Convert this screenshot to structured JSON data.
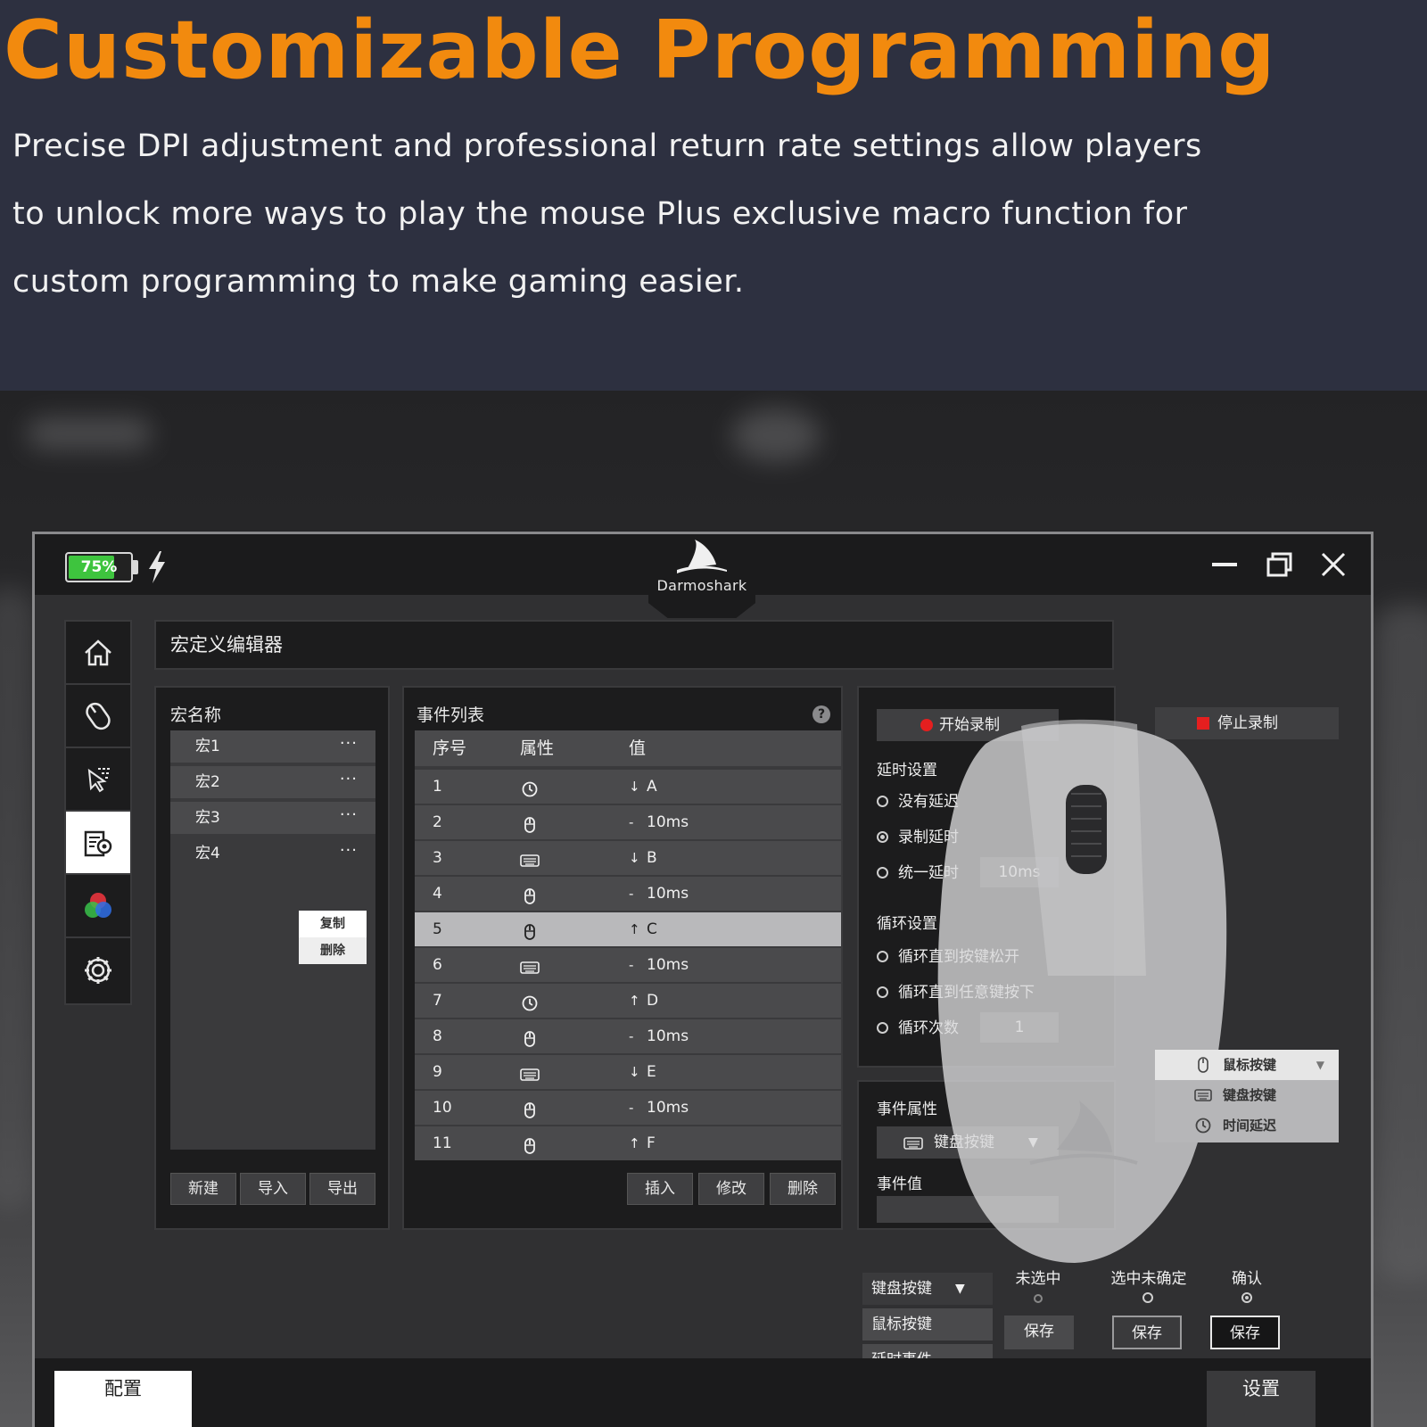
{
  "banner": {
    "title": "Customizable Programming",
    "description": "Precise DPI adjustment and professional return rate settings allow players to unlock more ways to play the mouse Plus exclusive macro function for custom programming to make gaming easier."
  },
  "colors": {
    "accent": "#f28a0e",
    "banner_bg": "#2d3040",
    "battery_green": "#3ec43e",
    "record_red": "#e51f1f"
  },
  "titlebar": {
    "battery": "75%",
    "battery_level": 0.75,
    "logo_text": "Darmoshark"
  },
  "icons": [
    "bolt-icon",
    "minimize-icon",
    "restore-icon",
    "close-icon",
    "home-icon",
    "mouse-icon",
    "cursor-select-icon",
    "macro-settings-icon",
    "color-rgb-icon",
    "gear-icon",
    "clock-icon",
    "mouse-small-icon",
    "keyboard-icon",
    "help-icon",
    "record-dot-icon",
    "stop-square-icon"
  ],
  "header": {
    "title": "宏定义编辑器"
  },
  "macro_panel": {
    "title": "宏名称",
    "items": [
      {
        "name": "宏1",
        "more": "···"
      },
      {
        "name": "宏2",
        "more": "···"
      },
      {
        "name": "宏3",
        "more": "···"
      },
      {
        "name": "宏4",
        "more": "···"
      }
    ],
    "context_menu": [
      "复制",
      "删除"
    ],
    "buttons": [
      "新建",
      "导入",
      "导出"
    ]
  },
  "event_panel": {
    "title": "事件列表",
    "help": "?",
    "columns": [
      "序号",
      "属性",
      "值"
    ],
    "rows": [
      {
        "idx": "1",
        "attr": "clock",
        "dir": "↓",
        "value": "A"
      },
      {
        "idx": "2",
        "attr": "mouse",
        "dir": "-",
        "value": "10ms"
      },
      {
        "idx": "3",
        "attr": "keyboard",
        "dir": "↓",
        "value": "B"
      },
      {
        "idx": "4",
        "attr": "mouse",
        "dir": "-",
        "value": "10ms"
      },
      {
        "idx": "5",
        "attr": "mouse",
        "dir": "↑",
        "value": "C"
      },
      {
        "idx": "6",
        "attr": "keyboard",
        "dir": "-",
        "value": "10ms"
      },
      {
        "idx": "7",
        "attr": "clock",
        "dir": "↑",
        "value": "D"
      },
      {
        "idx": "8",
        "attr": "mouse",
        "dir": "-",
        "value": "10ms"
      },
      {
        "idx": "9",
        "attr": "keyboard",
        "dir": "↓",
        "value": "E"
      },
      {
        "idx": "10",
        "attr": "mouse",
        "dir": "-",
        "value": "10ms"
      },
      {
        "idx": "11",
        "attr": "mouse",
        "dir": "↑",
        "value": "F"
      }
    ],
    "selected_row": "5",
    "buttons": [
      "插入",
      "修改",
      "删除"
    ]
  },
  "record": {
    "start": "开始录制",
    "stop": "停止录制"
  },
  "delay_settings": {
    "title": "延时设置",
    "options": [
      "没有延迟",
      "录制延时",
      "统一延时"
    ],
    "selected": "录制延时",
    "uniform_value": "10ms"
  },
  "loop_settings": {
    "title": "循环设置",
    "options": [
      "循环直到按键松开",
      "循环直到任意键按下",
      "循环次数"
    ],
    "count": "1"
  },
  "event_attr": {
    "title": "事件属性",
    "select_value": "键盘按键",
    "caret": "▼",
    "value_title": "事件值"
  },
  "dropdown_popup": {
    "items": [
      "鼠标按键",
      "键盘按键",
      "时间延迟"
    ],
    "caret": "▼"
  },
  "button_states": {
    "stack": [
      "键盘按键",
      "鼠标按键",
      "延时事件"
    ],
    "stack_caret": "▼",
    "columns": [
      "未选中",
      "选中未确定",
      "确认"
    ],
    "save_label": "保存"
  },
  "footer": {
    "left_tab": "配置",
    "right_tab": "设置"
  }
}
